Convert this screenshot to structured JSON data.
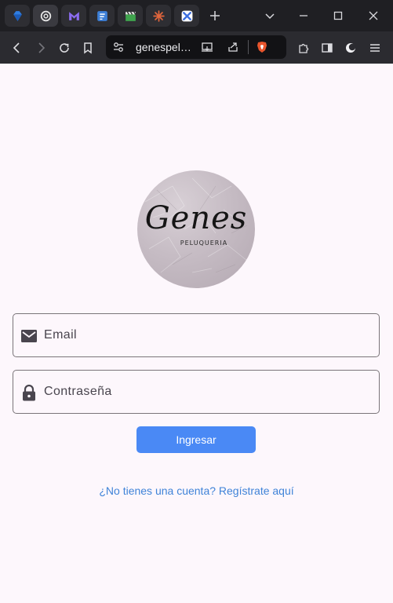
{
  "browser": {
    "tabs": [
      {
        "icon": "gem-icon",
        "active": false
      },
      {
        "icon": "openai-icon",
        "active": true
      },
      {
        "icon": "m-logo-icon",
        "active": false
      },
      {
        "icon": "document-list-icon",
        "active": false
      },
      {
        "icon": "clapperboard-icon",
        "active": false
      },
      {
        "icon": "sparkle-burst-icon",
        "active": false
      },
      {
        "icon": "tools-icon",
        "active": false
      }
    ],
    "new_tab_icon": "plus-icon",
    "url": "genespel…",
    "accent_colors": {
      "tabbar": "#1f1f23",
      "toolbar": "#2b2b30",
      "urlbar": "#121215"
    }
  },
  "page": {
    "logo": {
      "title": "Genes",
      "subtitle": "PELUQUERIA"
    },
    "email": {
      "placeholder": "Email",
      "value": ""
    },
    "password": {
      "placeholder": "Contraseña",
      "value": ""
    },
    "login_button": "Ingresar",
    "register_link": "¿No tienes una cuenta? Regístrate aquí",
    "colors": {
      "primary": "#4a89f5",
      "link": "#3f83d8",
      "background": "#fdf7fc",
      "border": "#7a7579"
    }
  }
}
